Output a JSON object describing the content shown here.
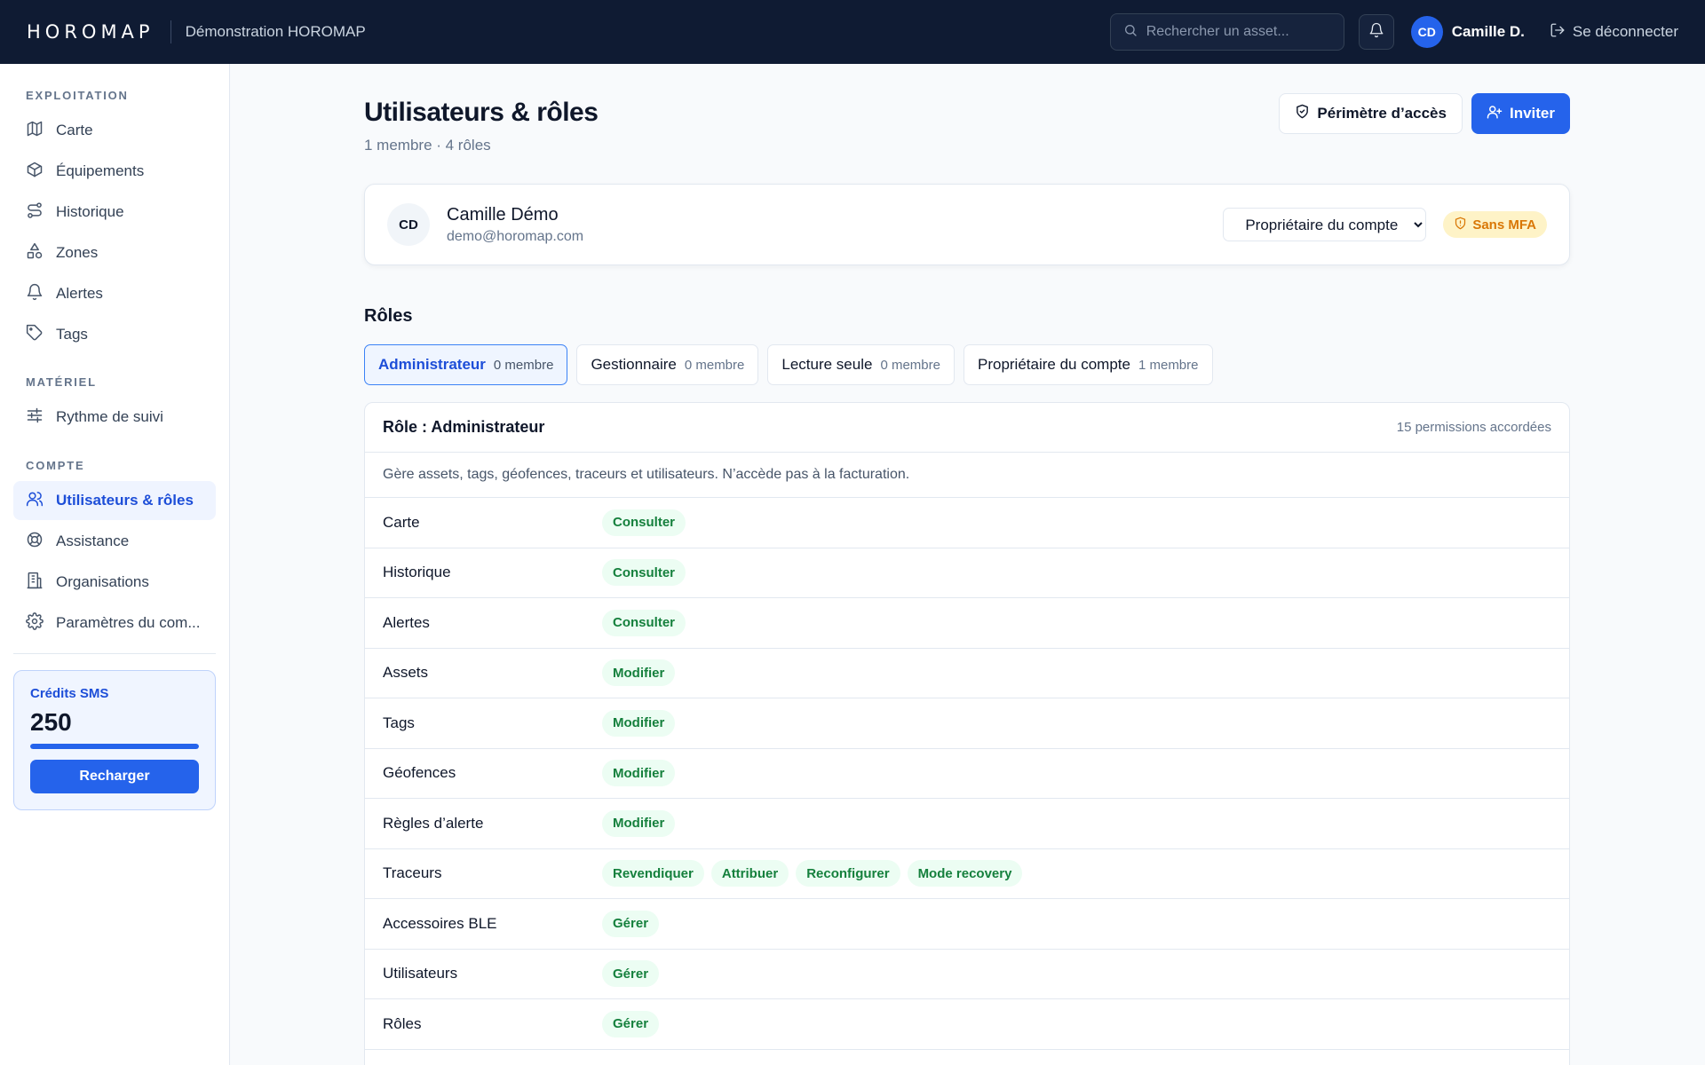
{
  "topbar": {
    "logo": "HOROMAP",
    "org_name": "Démonstration HOROMAP",
    "search_placeholder": "Rechercher un asset...",
    "user_initials": "CD",
    "user_name": "Camille D.",
    "logout_label": "Se déconnecter"
  },
  "sidebar": {
    "sections": [
      {
        "title": "EXPLOITATION"
      },
      {
        "title": "MATÉRIEL"
      },
      {
        "title": "COMPTE"
      }
    ],
    "items": [
      {
        "label": "Carte",
        "icon": "map-icon"
      },
      {
        "label": "Équipements",
        "icon": "box-icon"
      },
      {
        "label": "Historique",
        "icon": "route-icon"
      },
      {
        "label": "Zones",
        "icon": "shapes-icon"
      },
      {
        "label": "Alertes",
        "icon": "bell-icon"
      },
      {
        "label": "Tags",
        "icon": "tag-icon"
      },
      {
        "label": "Rythme de suivi",
        "icon": "sliders-icon"
      },
      {
        "label": "Utilisateurs & rôles",
        "icon": "users-icon",
        "active": true
      },
      {
        "label": "Assistance",
        "icon": "lifebuoy-icon"
      },
      {
        "label": "Organisations",
        "icon": "building-icon"
      },
      {
        "label": "Paramètres du com...",
        "icon": "gear-icon"
      }
    ],
    "sms": {
      "title": "Crédits SMS",
      "value": "250",
      "fill_fraction": 1.0,
      "button": "Recharger"
    }
  },
  "main": {
    "title": "Utilisateurs & rôles",
    "subtitle": "1 membre · 4 rôles",
    "scope_button": "Périmètre d’accès",
    "invite_button": "Inviter",
    "member": {
      "initials": "CD",
      "name": "Camille Démo",
      "email": "demo@horomap.com",
      "role_selected": "Propriétaire du compte",
      "mfa_badge": "Sans MFA"
    },
    "roles_title": "Rôles",
    "tabs": [
      {
        "label": "Administrateur",
        "count": "0 membre",
        "active": true
      },
      {
        "label": "Gestionnaire",
        "count": "0 membre"
      },
      {
        "label": "Lecture seule",
        "count": "0 membre"
      },
      {
        "label": "Propriétaire du compte",
        "count": "1 membre"
      }
    ],
    "role_detail": {
      "title": "Rôle : Administrateur",
      "permissions_count": "15 permissions accordées",
      "description": "Gère assets, tags, géofences, traceurs et utilisateurs. N’accède pas à la facturation.",
      "rows": [
        {
          "name": "Carte",
          "chips": [
            "Consulter"
          ]
        },
        {
          "name": "Historique",
          "chips": [
            "Consulter"
          ]
        },
        {
          "name": "Alertes",
          "chips": [
            "Consulter"
          ]
        },
        {
          "name": "Assets",
          "chips": [
            "Modifier"
          ]
        },
        {
          "name": "Tags",
          "chips": [
            "Modifier"
          ]
        },
        {
          "name": "Géofences",
          "chips": [
            "Modifier"
          ]
        },
        {
          "name": "Règles d’alerte",
          "chips": [
            "Modifier"
          ]
        },
        {
          "name": "Traceurs",
          "chips": [
            "Revendiquer",
            "Attribuer",
            "Reconfigurer",
            "Mode recovery"
          ]
        },
        {
          "name": "Accessoires BLE",
          "chips": [
            "Gérer"
          ]
        },
        {
          "name": "Utilisateurs",
          "chips": [
            "Gérer"
          ]
        },
        {
          "name": "Rôles",
          "chips": [
            "Gérer"
          ]
        }
      ]
    }
  },
  "colors": {
    "topbar": "#0f1b33",
    "accent": "#2563eb",
    "chip_bg": "#ecfdf3",
    "chip_text": "#15803d",
    "mfa_bg": "#fef3c7",
    "mfa_text": "#d97706"
  }
}
